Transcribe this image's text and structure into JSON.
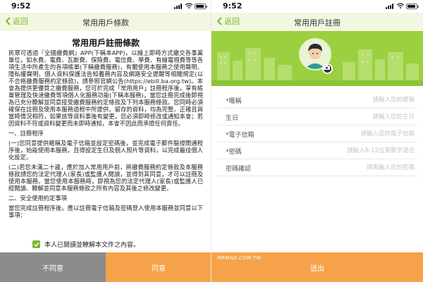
{
  "left": {
    "status": {
      "time": "9:52"
    },
    "nav": {
      "back_label": "返回",
      "title": "常用用戶條款"
    },
    "terms": {
      "heading": "常用用戶註冊條款",
      "paragraphs": [
        "民眾可透過『全國繳費網』APP(下稱本APP)，以線上即時方式繳交各事業單位，如水費、電費、瓦斯費、保險費、電信費、學費、有線電視費等等各項生活中所產生的各項帳單(下稱繳費服務)，有關使用本服務之使用聲明、隱私權聲明、個人資料保護法告知義務內容及網路安全提醒等相關規定(以不合格繳費服務約定條款)，請參照官網公告(https://ebill.ba.org.tw)。本會為提供更優質之繳費服務，您可於完成「常用用戶」註冊程序後，享有帳單管理及快速繳費等項個人化服務功能(下稱本服務)，當您註冊完成後即視為已充分瞭解並同意接受繳費服務約定條款及下列本服務條款。您同時必須確保在註冊及使用本服務過程中所提供、留存的資料，均為完整、正確且與當時情況相符，如果該等資料事後有變更，您必須即時修改或通知本會；若因資料不符或資料變更而未即時通知，本會不因此而承擔任何責任。",
        "一、註冊程序",
        "(一)您同意提供暱稱及電子信箱並設定密碼後，並完成電子郵件驗證開通程序後，始能使用本服務，且得設定生日及個人照片等資料，以完成最佳個人化設定。",
        "(二)若您未滿二十歲，應於加入常用用戶前，將繳費服務約定條款及本服務條款請您的法定代理人(家長)或監護人閱讀，並得到其同意，才可以註冊及使用本服務。當您使用本服務時，即視為您的法定代理人(家長)或監護人已經閱讀、瞭解並同意本服務條款之所有內容及其後之修改變更。",
        "二、安全使用約定事項",
        "當您完成註冊程序後，應以註冊電子信箱及密碼登入使用本服務並同意以下事項："
      ]
    },
    "agree_text": "本人已閱讀並瞭解本文件之內容。",
    "footer": {
      "disagree_label": "不同意",
      "agree_label": "同意"
    }
  },
  "right": {
    "status": {
      "time": "9:52"
    },
    "nav": {
      "back_label": "返回",
      "title": "常用用戶註冊"
    },
    "form": {
      "fields": [
        {
          "label": "*暱稱",
          "placeholder": "請輸入您的暱稱"
        },
        {
          "label": "生日",
          "placeholder": "請輸入您的生日"
        },
        {
          "label": "*電子信箱",
          "placeholder": "請輸入您的電子信箱"
        },
        {
          "label": "*密碼",
          "placeholder": "請輸入8-12位英數字混合"
        },
        {
          "label": "密碼確認",
          "placeholder": "請再輸入您的密碼"
        }
      ]
    },
    "submit_label": "送出",
    "watermark": "MRMAD.COM.TW"
  },
  "colors": {
    "accent_green": "#7cb92e",
    "banner_green": "#9bd040",
    "nav_bg": "#f1f7e0",
    "orange": "#f5a24a",
    "gray": "#8c8c8c"
  },
  "icons": [
    "back-chevron-icon",
    "signal-icon",
    "wifi-icon",
    "battery-icon",
    "check-icon",
    "avatar-icon",
    "camera-icon"
  ]
}
